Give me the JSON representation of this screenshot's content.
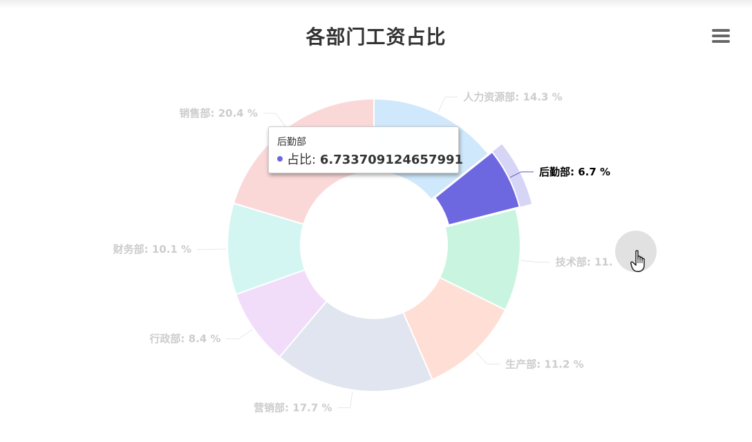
{
  "chart_data": {
    "type": "pie",
    "style": "donut",
    "title": "各部门工资占比",
    "slices": [
      {
        "name": "人力资源部",
        "label": "人力资源部: 14.3 %",
        "value": 14.3,
        "color": "#cfe8fb",
        "highlighted": false
      },
      {
        "name": "后勤部",
        "label": "后勤部: 6.7 %",
        "value": 6.733709124657991,
        "color": "#6d67e0",
        "highlighted": true
      },
      {
        "name": "技术部",
        "label": "技术部: 11.",
        "value": 11.3,
        "color": "#c9f5e0",
        "highlighted": false
      },
      {
        "name": "生产部",
        "label": "生产部: 11.2 %",
        "value": 11.2,
        "color": "#ffded6",
        "highlighted": false
      },
      {
        "name": "营销部",
        "label": "营销部: 17.7 %",
        "value": 17.7,
        "color": "#e1e5f0",
        "highlighted": false
      },
      {
        "name": "行政部",
        "label": "行政部: 8.4 %",
        "value": 8.4,
        "color": "#f1dcfa",
        "highlighted": false
      },
      {
        "name": "财务部",
        "label": "财务部: 10.1 %",
        "value": 10.1,
        "color": "#d4f6f3",
        "highlighted": false
      },
      {
        "name": "销售部",
        "label": "销售部: 20.4 %",
        "value": 20.4,
        "color": "#fbd8d8",
        "highlighted": false
      }
    ],
    "label_color_muted": "#cccccc",
    "label_color_active": "#000000",
    "connector_color_active": "#5b55c6"
  },
  "tooltip": {
    "title": "后勤部",
    "series_label": "占比:",
    "value": "6.733709124657991",
    "marker_color": "#6d67e0"
  },
  "toolbar": {
    "menu_icon": "hamburger-menu-icon"
  }
}
